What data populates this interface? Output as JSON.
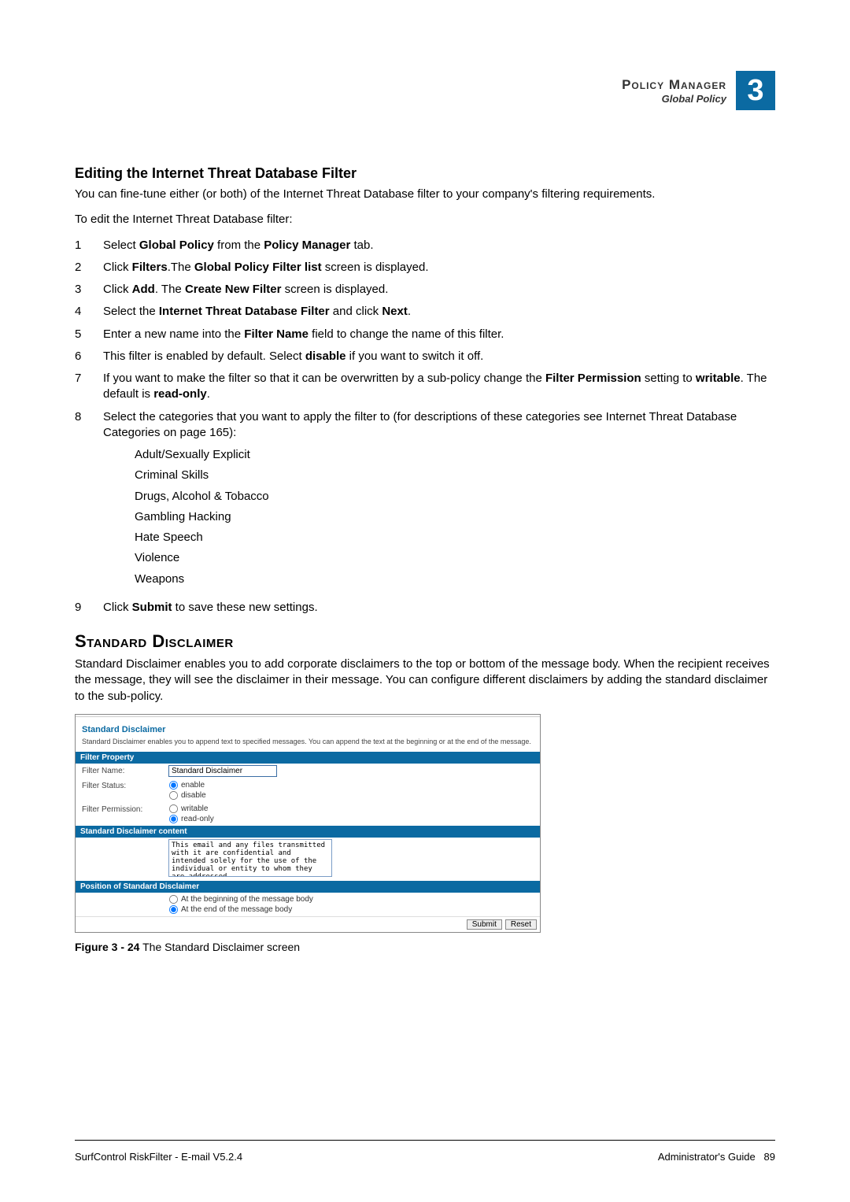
{
  "header": {
    "title": "Policy Manager",
    "subtitle": "Global Policy",
    "chapter": "3"
  },
  "section1": {
    "heading": "Editing the Internet Threat Database Filter",
    "intro": "You can fine-tune either (or both) of the Internet Threat Database filter to your company's filtering requirements.",
    "lead": "To edit the Internet Threat Database filter:"
  },
  "steps": {
    "s1": {
      "n": "1",
      "pre": "Select ",
      "b1": "Global Policy",
      "mid": " from the ",
      "b2": "Policy Manager",
      "post": " tab."
    },
    "s2": {
      "n": "2",
      "pre": "Click ",
      "b1": "Filters",
      "mid": ".The ",
      "b2": "Global Policy Filter list",
      "post": " screen is displayed."
    },
    "s3": {
      "n": "3",
      "pre": "Click ",
      "b1": "Add",
      "mid": ". The ",
      "b2": "Create New Filter",
      "post": " screen is displayed."
    },
    "s4": {
      "n": "4",
      "pre": "Select the ",
      "b1": "Internet Threat Database Filter",
      "mid": " and click ",
      "b2": "Next",
      "post": "."
    },
    "s5": {
      "n": "5",
      "pre": "Enter a new name into the ",
      "b1": "Filter Name",
      "post": " field to change the name of this filter."
    },
    "s6": {
      "n": "6",
      "pre": "This filter is enabled by default. Select ",
      "b1": "disable",
      "post": " if you want to switch it off."
    },
    "s7": {
      "n": "7",
      "pre": "If you want to make the filter so that it can be overwritten by a sub-policy change the ",
      "b1": "Filter Permission",
      "mid": " setting to ",
      "b2": "writable",
      "mid2": ". The default is ",
      "b3": "read-only",
      "post": "."
    },
    "s8": {
      "n": "8",
      "text": "Select the categories that you want to apply the filter to (for descriptions of these categories see Internet Threat Database Categories on page 165):"
    },
    "s9": {
      "n": "9",
      "pre": "Click ",
      "b1": "Submit",
      "post": " to save these new settings."
    }
  },
  "categories": {
    "c1": "Adult/Sexually Explicit",
    "c2": "Criminal Skills",
    "c3": "Drugs, Alcohol & Tobacco",
    "c4": "Gambling Hacking",
    "c5": "Hate Speech",
    "c6": "Violence",
    "c7": "Weapons"
  },
  "section2": {
    "heading": "Standard Disclaimer",
    "para": "Standard Disclaimer enables you to add corporate disclaimers to the top or bottom of the message body. When the recipient receives the message, they  will see the disclaimer in their message. You can configure different disclaimers by adding the standard disclaimer to the sub-policy."
  },
  "shot": {
    "title": "Standard Disclaimer",
    "desc": "Standard Disclaimer enables you to append text to specified messages. You can append the text at the beginning or at the end of the message.",
    "bar1": "Filter Property",
    "row_name_label": "Filter Name:",
    "row_name_value": "Standard Disclaimer",
    "row_status_label": "Filter Status:",
    "row_status_opt1": "enable",
    "row_status_opt2": "disable",
    "row_perm_label": "Filter Permission:",
    "row_perm_opt1": "writable",
    "row_perm_opt2": "read-only",
    "bar2": "Standard Disclaimer content",
    "content_value": "This email and any files transmitted with it are confidential and intended solely for the use of the individual or entity to whom they are addressed.",
    "bar3": "Position of Standard Disclaimer",
    "pos_opt1": "At the beginning of the message body",
    "pos_opt2": "At the end of the message body",
    "btn_submit": "Submit",
    "btn_reset": "Reset"
  },
  "caption": {
    "label": "Figure 3 - 24",
    "text": " The Standard Disclaimer screen"
  },
  "footer": {
    "left": "SurfControl RiskFilter - E-mail V5.2.4",
    "right_label": "Administrator's Guide",
    "page": "89"
  }
}
